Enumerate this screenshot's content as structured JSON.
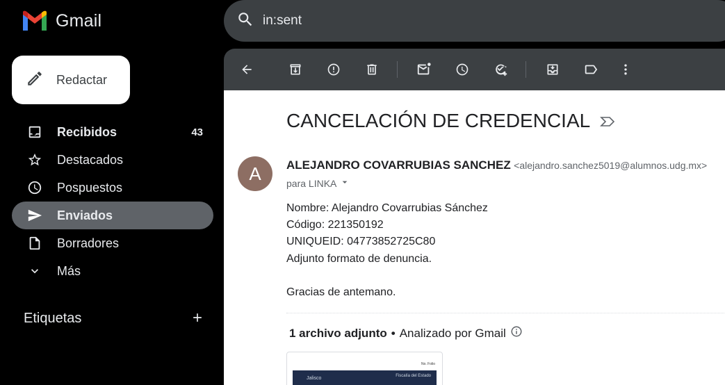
{
  "app": {
    "name": "Gmail"
  },
  "compose": {
    "label": "Redactar"
  },
  "search": {
    "value": "in:sent"
  },
  "nav": {
    "items": [
      {
        "label": "Recibidos",
        "count": "43",
        "icon": "inbox-icon"
      },
      {
        "label": "Destacados",
        "icon": "star-icon"
      },
      {
        "label": "Pospuestos",
        "icon": "clock-icon"
      },
      {
        "label": "Enviados",
        "icon": "send-icon"
      },
      {
        "label": "Borradores",
        "icon": "draft-icon"
      },
      {
        "label": "Más",
        "icon": "chevron-down-icon"
      }
    ]
  },
  "labels": {
    "title": "Etiquetas"
  },
  "toolbar": {
    "icons": [
      "back-arrow-icon",
      "archive-icon",
      "report-spam-icon",
      "delete-icon",
      "mark-unread-icon",
      "snooze-icon",
      "add-task-icon",
      "move-to-icon",
      "label-icon",
      "more-icon"
    ]
  },
  "email": {
    "subject": "CANCELACIÓN DE CREDENCIAL",
    "avatar_letter": "A",
    "sender_name": "ALEJANDRO COVARRUBIAS SANCHEZ",
    "sender_email": "<alejandro.sanchez5019@alumnos.udg.mx>",
    "recipient": "para LINKA",
    "body": [
      "Nombre: Alejandro Covarrubias Sánchez",
      "Código: 221350192",
      "UNIQUEID: 04773852725C80",
      "Adjunto formato de denuncia.",
      "",
      "Gracias de antemano."
    ],
    "attachments": {
      "count_label": "1 archivo adjunto",
      "separator": "•",
      "scan_label": "Analizado por Gmail"
    },
    "thumbnail": {
      "folio": "No. Folio",
      "left_text": "Jalisco",
      "right_text": "Fiscalía del Estado"
    }
  },
  "colors": {
    "background": "#000000",
    "search_bg": "#3c4043",
    "active_nav": "#5f6368",
    "avatar": "#8d6e63"
  }
}
